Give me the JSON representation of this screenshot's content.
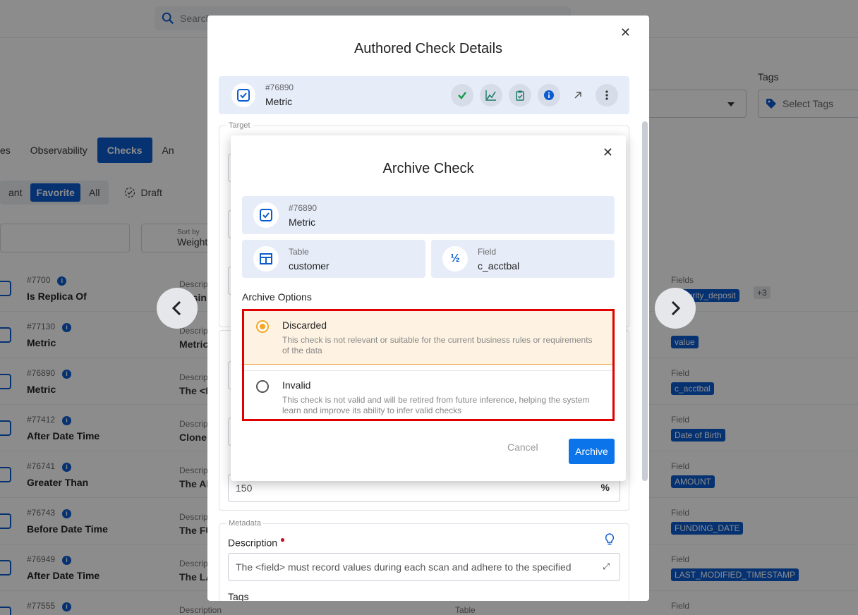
{
  "background": {
    "search_placeholder": "Search",
    "tags_label": "Tags",
    "tags_placeholder": "Select Tags",
    "tabs": [
      "es",
      "Observability",
      "Checks",
      "An"
    ],
    "active_tab": "Checks",
    "filters": [
      "ant",
      "Favorite",
      "All"
    ],
    "draft_label": "Draft",
    "sort_by_label": "Sort by",
    "sort_by_value": "Weight",
    "description_label": "Description",
    "table_label": "Table",
    "field_label": "Field",
    "fields_label": "Fields",
    "rows": [
      {
        "id": "#7700",
        "name": "Is Replica Of",
        "desc": "Busin",
        "field_label": "Fields",
        "field": "security_deposit",
        "more": "+3"
      },
      {
        "id": "#77130",
        "name": "Metric",
        "desc": "Metric",
        "field_label": "",
        "field": "value",
        "more": ""
      },
      {
        "id": "#76890",
        "name": "Metric",
        "desc": "The <f",
        "field_label": "Field",
        "field": "c_acctbal",
        "more": ""
      },
      {
        "id": "#77412",
        "name": "After Date Time",
        "desc": "Clone",
        "field_label": "Field",
        "field": "Date of Birth",
        "more": ""
      },
      {
        "id": "#76741",
        "name": "Greater Than",
        "desc": "The AM",
        "field_label": "Field",
        "field": "AMOUNT",
        "more": ""
      },
      {
        "id": "#76743",
        "name": "Before Date Time",
        "desc": "The FU",
        "field_label": "Field",
        "field": "FUNDING_DATE",
        "more": ""
      },
      {
        "id": "#76949",
        "name": "After Date Time",
        "desc": "The LA",
        "field_label": "Field",
        "field": "LAST_MODIFIED_TIMESTAMP",
        "more": ""
      },
      {
        "id": "#77555",
        "name": "",
        "desc": "",
        "field_label": "Field",
        "field": "",
        "more": ""
      }
    ]
  },
  "details_modal": {
    "title": "Authored Check Details",
    "check_id": "#76890",
    "check_type": "Metric",
    "target_legend": "Target",
    "metadata_legend": "Metadata",
    "value_field": "150",
    "value_suffix": "%",
    "description_label": "Description",
    "description_value": "The <field> must record values during each scan and adhere to the specified",
    "tags_label": "Tags"
  },
  "archive_modal": {
    "title": "Archive Check",
    "check_id": "#76890",
    "check_type": "Metric",
    "table_label": "Table",
    "table_value": "customer",
    "field_label": "Field",
    "field_value": "c_acctbal",
    "options_title": "Archive Options",
    "options": [
      {
        "title": "Discarded",
        "desc": "This check is not relevant or suitable for the current business rules or requirements of the data",
        "selected": true
      },
      {
        "title": "Invalid",
        "desc": "This check is not valid and will be retired from future inference, helping the system learn and improve its ability to infer valid checks",
        "selected": false
      }
    ],
    "cancel_label": "Cancel",
    "archive_label": "Archive"
  },
  "icons": {
    "close": "close-icon",
    "prev": "chevron-left-icon",
    "next": "chevron-right-icon"
  },
  "colors": {
    "primary": "#0b5ccf",
    "archive_button": "#0b74ea",
    "selected_option_bg": "#fef3e2",
    "highlight_border": "#e00000"
  }
}
